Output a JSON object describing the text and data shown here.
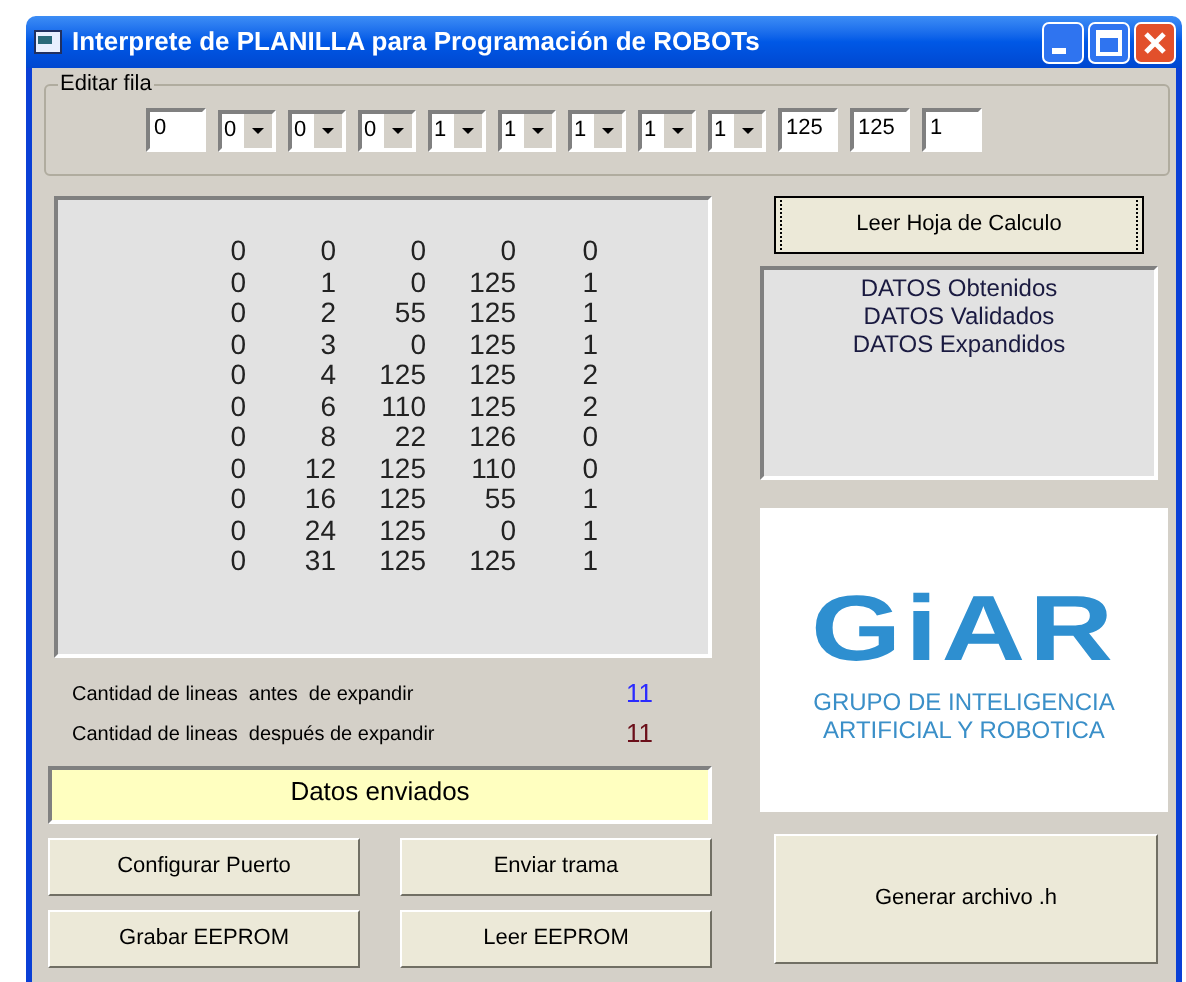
{
  "window": {
    "title": "Interprete de PLANILLA para Programación de ROBOTs"
  },
  "edit_row": {
    "label": "Editar fila",
    "fields": [
      {
        "kind": "text",
        "value": "0"
      },
      {
        "kind": "combo",
        "value": "0"
      },
      {
        "kind": "combo",
        "value": "0"
      },
      {
        "kind": "combo",
        "value": "0"
      },
      {
        "kind": "combo",
        "value": "1"
      },
      {
        "kind": "combo",
        "value": "1"
      },
      {
        "kind": "combo",
        "value": "1"
      },
      {
        "kind": "combo",
        "value": "1"
      },
      {
        "kind": "combo",
        "value": "1"
      },
      {
        "kind": "text",
        "value": "125"
      },
      {
        "kind": "text",
        "value": "125"
      },
      {
        "kind": "text",
        "value": "1"
      }
    ]
  },
  "data_list": {
    "rows": [
      [
        "0",
        "0",
        "0",
        "0",
        "0"
      ],
      [
        "0",
        "1",
        "0",
        "125",
        "1"
      ],
      [
        "0",
        "2",
        "55",
        "125",
        "1"
      ],
      [
        "0",
        "3",
        "0",
        "125",
        "1"
      ],
      [
        "0",
        "4",
        "125",
        "125",
        "2"
      ],
      [
        "0",
        "6",
        "110",
        "125",
        "2"
      ],
      [
        "0",
        "8",
        "22",
        "126",
        "0"
      ],
      [
        "0",
        "12",
        "125",
        "110",
        "0"
      ],
      [
        "0",
        "16",
        "125",
        "55",
        "1"
      ],
      [
        "0",
        "24",
        "125",
        "0",
        "1"
      ],
      [
        "0",
        "31",
        "125",
        "125",
        "1"
      ]
    ]
  },
  "read_button": {
    "label": "Leer Hoja de Calculo",
    "focused": true
  },
  "status_lines": [
    "DATOS Obtenidos",
    "DATOS Validados",
    "DATOS Expandidos"
  ],
  "counts": [
    {
      "label": "Cantidad de lineas  antes  de expandir",
      "value": "11",
      "color": "#2b2bff"
    },
    {
      "label": "Cantidad de lineas  después de expandir",
      "value": "11",
      "color": "#6b0f1a"
    }
  ],
  "message": "Datos enviados",
  "buttons": [
    "Configurar Puerto",
    "Enviar trama",
    "Grabar EEPROM",
    "Leer EEPROM"
  ],
  "logo": {
    "title": "GiAR",
    "subtitle": [
      "GRUPO DE INTELIGENCIA",
      "ARTIFICIAL Y ROBOTICA"
    ]
  },
  "generate_button": {
    "label": "Generar archivo .h"
  }
}
